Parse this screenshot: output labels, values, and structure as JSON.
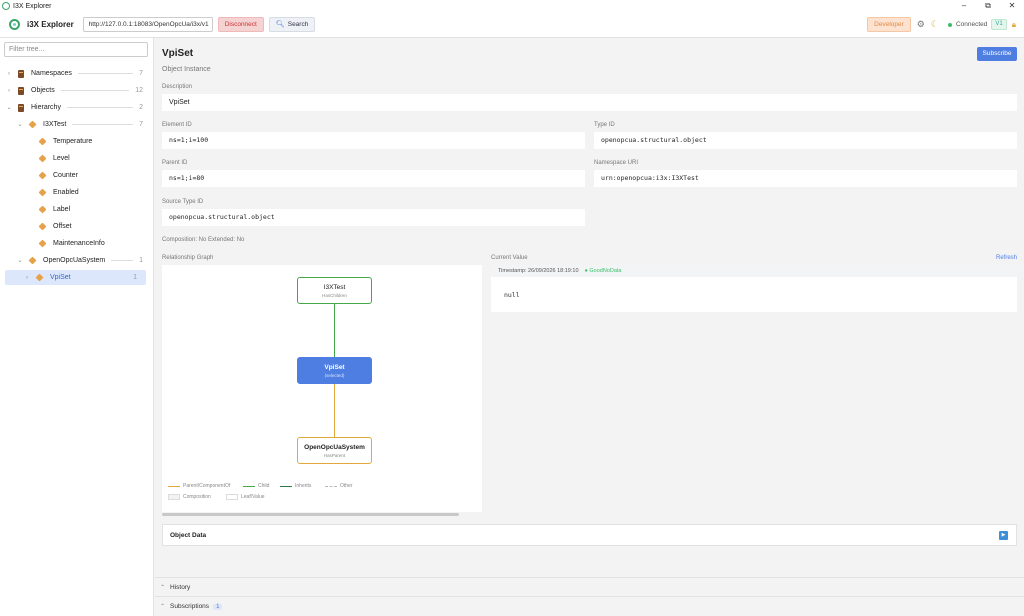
{
  "window": {
    "title": "I3X Explorer",
    "controls": [
      "–",
      "⧉",
      "✕"
    ]
  },
  "header": {
    "app_name": "i3X Explorer",
    "url": "http://127.0.0.1:18083/OpenOpcUa/i3x/v1",
    "disconnect_label": "Disconnect",
    "search_label": "Search",
    "developer_label": "Developer",
    "status_label": "Connected",
    "version_badge": "V1"
  },
  "sidebar": {
    "filter_placeholder": "Filter tree...",
    "items": [
      {
        "label": "Namespaces",
        "count": "7"
      },
      {
        "label": "Objects",
        "count": "12"
      },
      {
        "label": "Hierarchy",
        "count": "2"
      },
      {
        "label": "I3XTest",
        "count": "7"
      },
      {
        "label": "Temperature"
      },
      {
        "label": "Level"
      },
      {
        "label": "Counter"
      },
      {
        "label": "Enabled"
      },
      {
        "label": "Label"
      },
      {
        "label": "Offset"
      },
      {
        "label": "MaintenanceInfo"
      },
      {
        "label": "OpenOpcUaSystem",
        "count": "1"
      },
      {
        "label": "VpiSet",
        "count": "1"
      }
    ]
  },
  "main": {
    "title": "VpiSet",
    "subtitle": "Object Instance",
    "subscribe_label": "Subscribe",
    "fields": {
      "description": {
        "label": "Description",
        "value": "VpiSet"
      },
      "element_id": {
        "label": "Element ID",
        "value": "ns=1;i=100"
      },
      "type_id": {
        "label": "Type ID",
        "value": "openopcua.structural.object"
      },
      "parent_id": {
        "label": "Parent ID",
        "value": "ns=1;i=80"
      },
      "namespace_uri": {
        "label": "Namespace URI",
        "value": "urn:openopcua:i3x:I3XTest"
      },
      "source_type_id": {
        "label": "Source Type ID",
        "value": "openopcua.structural.object"
      }
    },
    "composition_line": "Composition: No    Extended: No",
    "graph": {
      "label": "Relationship Graph",
      "nodes": [
        {
          "name": "I3XTest",
          "rel": "HasChildren"
        },
        {
          "name": "VpiSet",
          "rel": "(selected)"
        },
        {
          "name": "OpenOpcUaSystem",
          "rel": "HasParent"
        }
      ],
      "legend": [
        "Parent/ComponentOf",
        "Child",
        "Inherits",
        "Other",
        "Composition",
        "Leaf/Value"
      ],
      "colors": {
        "parent": "#e0a93a",
        "child": "#44a848",
        "inherits": "#2d7a4a",
        "other": "#bbbbbb",
        "selected": "#4f7ee3"
      }
    },
    "current_value": {
      "label": "Current Value",
      "refresh_label": "Refresh",
      "timestamp": "Timestamp: 26/09/2026 18:19:10",
      "quality": "● GoodNoData",
      "value": "null"
    },
    "object_data_label": "Object Data",
    "history_label": "History",
    "subscriptions_label": "Subscriptions",
    "subscriptions_count": "1"
  }
}
